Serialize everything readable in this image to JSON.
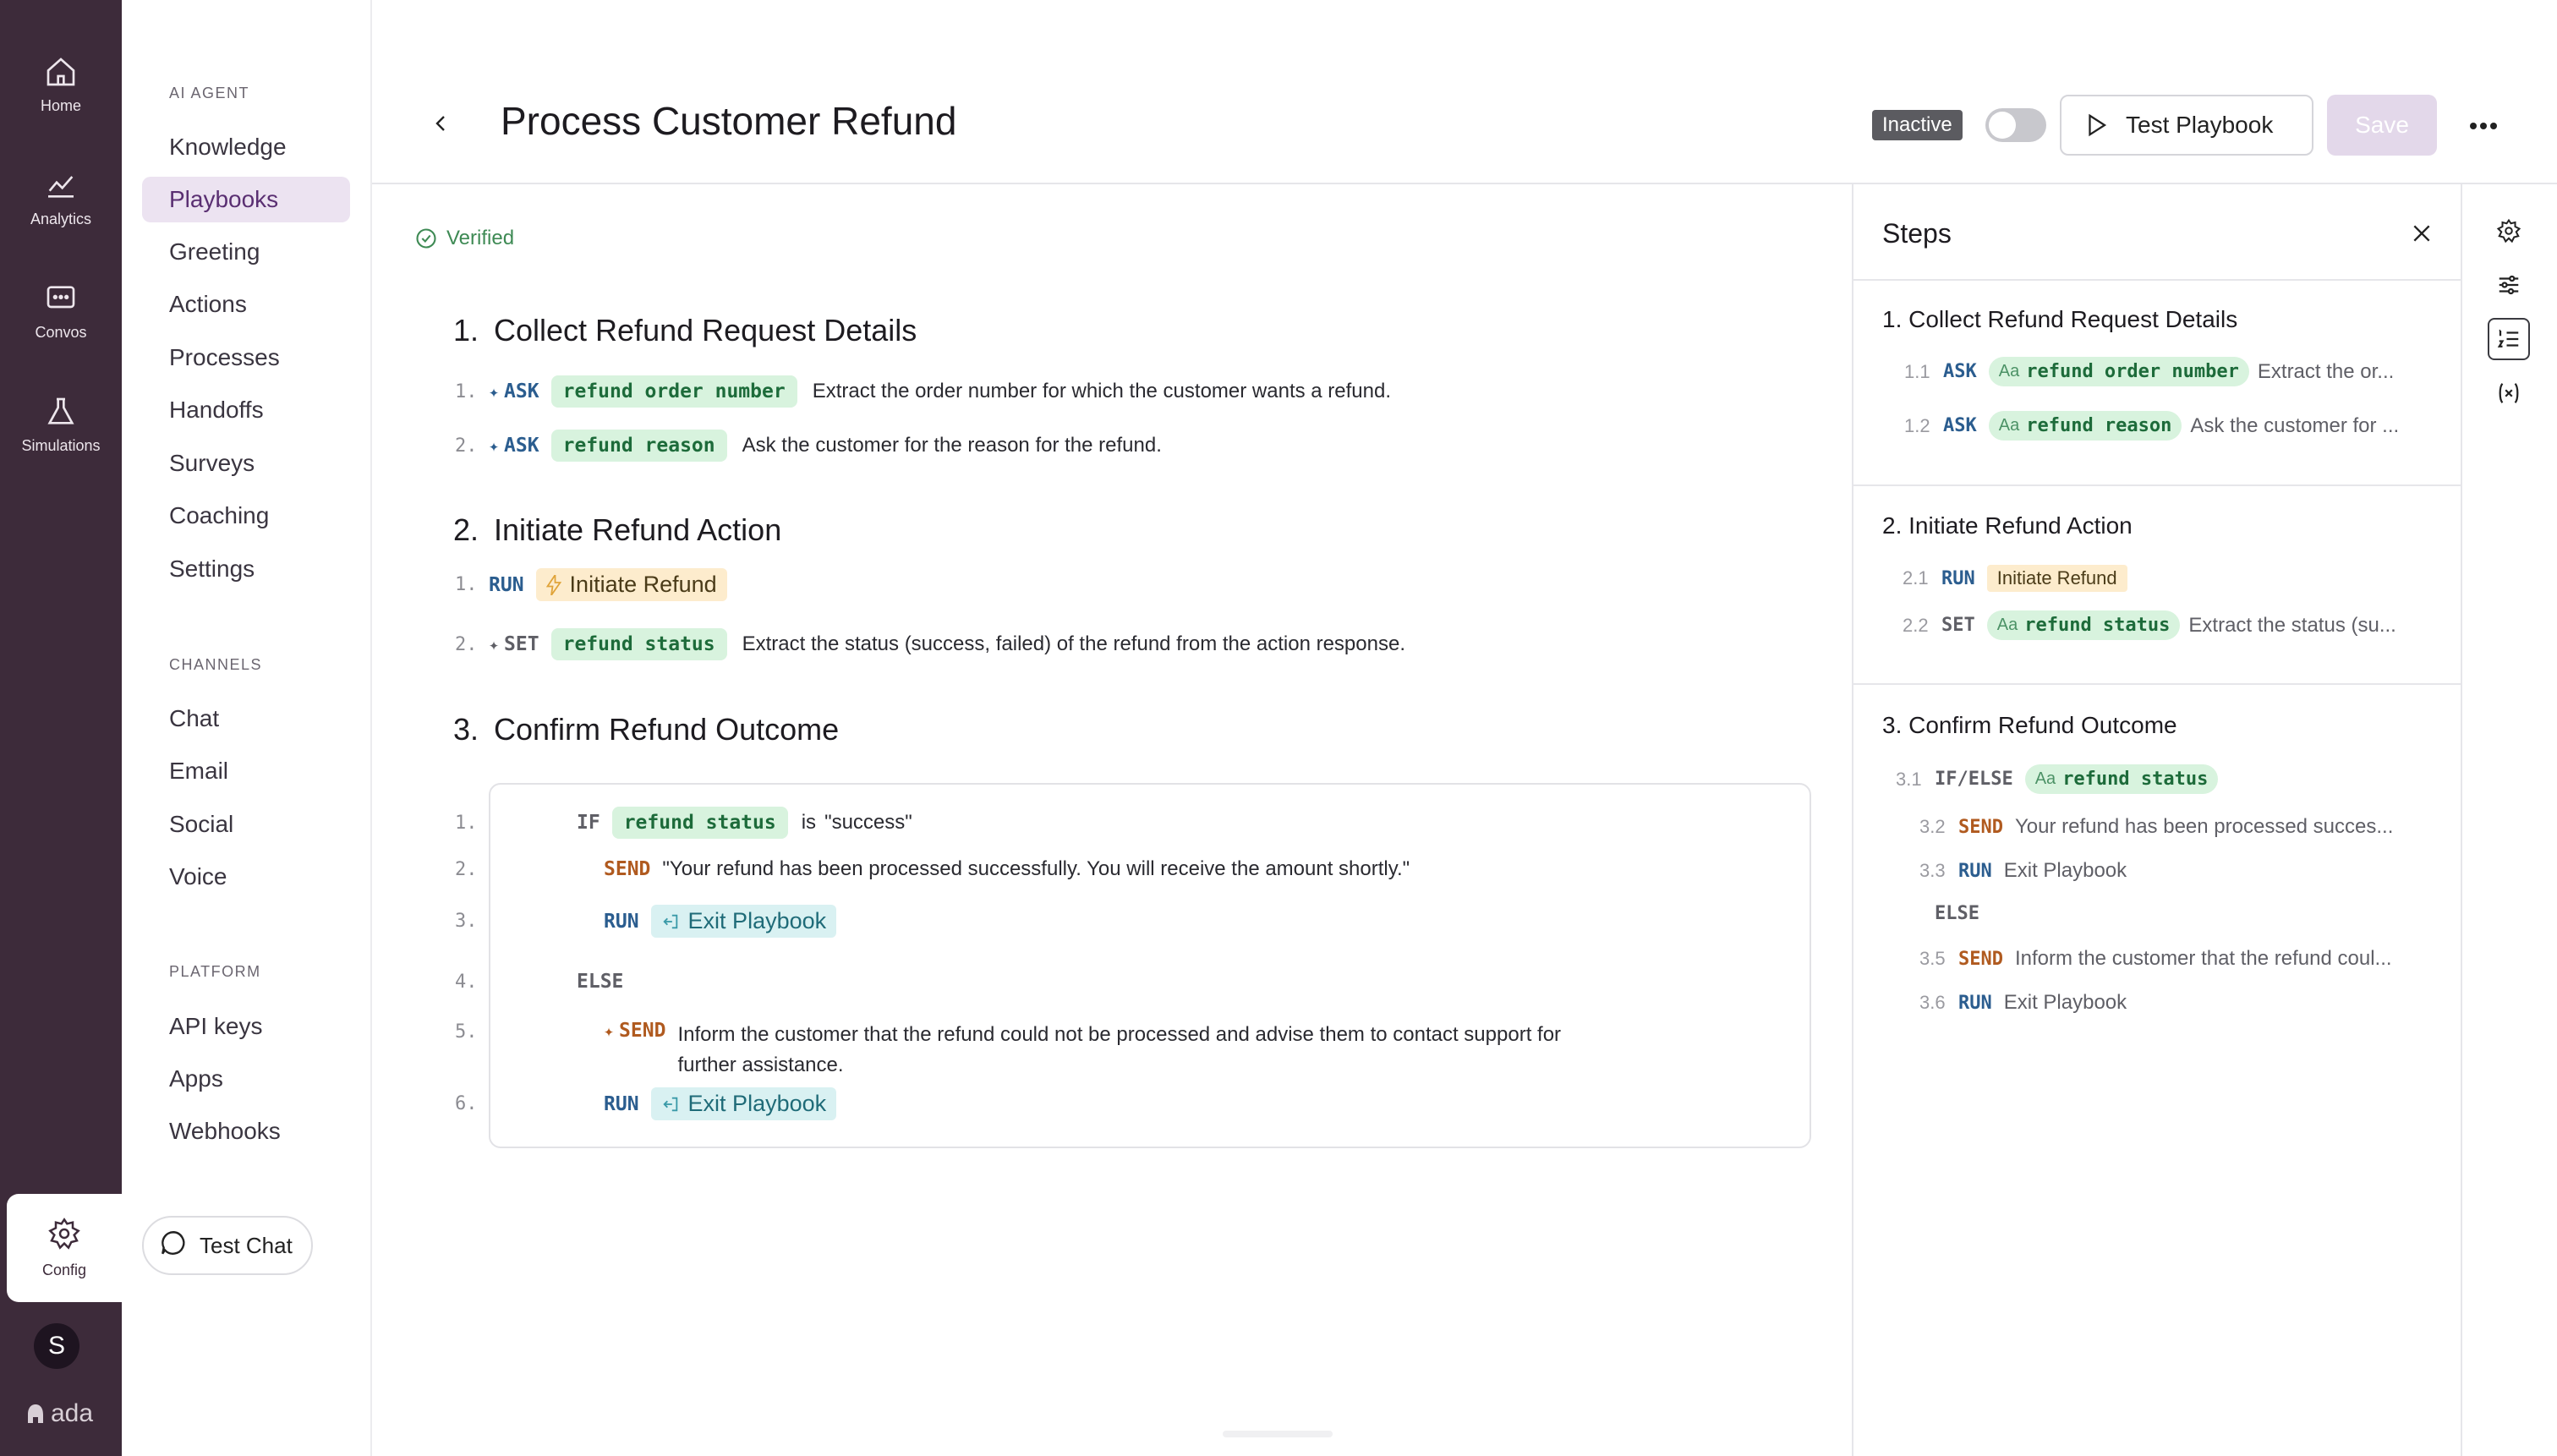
{
  "rail": {
    "items": [
      {
        "label": "Home",
        "icon": "home-icon"
      },
      {
        "label": "Analytics",
        "icon": "analytics-icon"
      },
      {
        "label": "Convos",
        "icon": "chat-icon"
      },
      {
        "label": "Simulations",
        "icon": "flask-icon"
      }
    ],
    "config_label": "Config",
    "avatar_letter": "S",
    "logo_text": "ada"
  },
  "subnav": {
    "section_ai": "AI AGENT",
    "ai_items": [
      "Knowledge",
      "Playbooks",
      "Greeting",
      "Actions",
      "Processes",
      "Handoffs",
      "Surveys",
      "Coaching",
      "Settings"
    ],
    "active_item": "Playbooks",
    "section_channels": "CHANNELS",
    "channel_items": [
      "Chat",
      "Email",
      "Social",
      "Voice"
    ],
    "section_platform": "PLATFORM",
    "platform_items": [
      "API keys",
      "Apps",
      "Webhooks"
    ],
    "test_chat": "Test Chat"
  },
  "header": {
    "title": "Process Customer Refund",
    "status_badge": "Inactive",
    "test_button": "Test Playbook",
    "save_button": "Save"
  },
  "editor": {
    "verified": "Verified",
    "sections": [
      {
        "num": "1.",
        "title": "Collect Refund Request Details",
        "rows": [
          {
            "ln": "1.",
            "kw": "ASK",
            "var": "refund order number",
            "text": "Extract the order number for which the customer wants a refund."
          },
          {
            "ln": "2.",
            "kw": "ASK",
            "var": "refund reason",
            "text": "Ask the customer for the reason for the refund."
          }
        ]
      },
      {
        "num": "2.",
        "title": "Initiate Refund Action",
        "rows": [
          {
            "ln": "1.",
            "kw": "RUN",
            "action": "Initiate Refund"
          },
          {
            "ln": "2.",
            "kw": "SET",
            "var": "refund status",
            "text": "Extract the status (success, failed) of the refund from the action response."
          }
        ]
      },
      {
        "num": "3.",
        "title": "Confirm Refund Outcome",
        "rows": [
          {
            "ln": "1.",
            "kw": "IF",
            "var": "refund status",
            "op": "is",
            "value": "\"success\""
          },
          {
            "ln": "2.",
            "kw": "SEND",
            "text": "\"Your refund has been processed successfully. You will receive the amount shortly.\""
          },
          {
            "ln": "3.",
            "kw": "RUN",
            "action": "Exit Playbook"
          },
          {
            "ln": "4.",
            "kw": "ELSE"
          },
          {
            "ln": "5.",
            "kw": "SEND",
            "text": "Inform the customer that the refund could not be processed and advise them to contact support for",
            "text2": "further assistance."
          },
          {
            "ln": "6.",
            "kw": "RUN",
            "action": "Exit Playbook"
          }
        ]
      }
    ]
  },
  "steps": {
    "title": "Steps",
    "groups": [
      {
        "title": "1. Collect Refund Request Details",
        "rows": [
          {
            "ln": "1.1",
            "kw": "ASK",
            "var": "refund order number",
            "text": "Extract the or..."
          },
          {
            "ln": "1.2",
            "kw": "ASK",
            "var": "refund reason",
            "text": "Ask the customer for ..."
          }
        ]
      },
      {
        "title": "2. Initiate Refund Action",
        "rows": [
          {
            "ln": "2.1",
            "kw": "RUN",
            "action": "Initiate Refund"
          },
          {
            "ln": "2.2",
            "kw": "SET",
            "var": "refund status",
            "text": "Extract the status (su..."
          }
        ]
      },
      {
        "title": "3. Confirm Refund Outcome",
        "rows": [
          {
            "ln": "3.1",
            "kw": "IF/ELSE",
            "var": "refund status"
          },
          {
            "ln": "3.2",
            "kw": "SEND",
            "text": "Your refund has been processed succes..."
          },
          {
            "ln": "3.3",
            "kw": "RUN",
            "text": "Exit Playbook"
          },
          {
            "kw": "ELSE"
          },
          {
            "ln": "3.5",
            "kw": "SEND",
            "text": "Inform the customer that the refund coul..."
          },
          {
            "ln": "3.6",
            "kw": "RUN",
            "text": "Exit Playbook"
          }
        ]
      }
    ],
    "aa_label": "Aa"
  },
  "right_rail": [
    "settings-icon",
    "sliders-icon",
    "numbered-list-icon",
    "variable-icon"
  ],
  "colors": {
    "rail_bg": "#3d2b3a",
    "active_nav_bg": "#ece3f1",
    "variable_pill": "#d8f3de",
    "action_pill": "#fdeccd",
    "exit_pill": "#d9f1f2",
    "keyword_blue": "#2b5d8f",
    "keyword_orange": "#b05a1f",
    "verified_green": "#3e8a54"
  }
}
